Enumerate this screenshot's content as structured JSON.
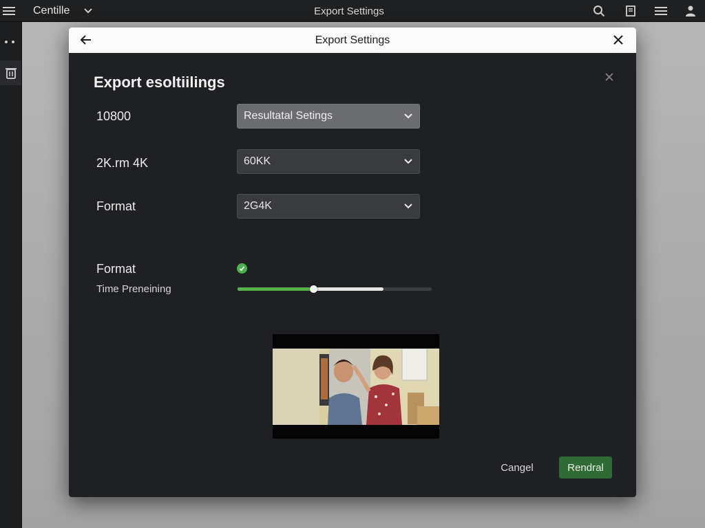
{
  "app": {
    "brand": "Centille",
    "window_title": "Export Settings"
  },
  "dialog": {
    "header_title": "Export Settings",
    "heading": "Export esoltiilings",
    "rows": [
      {
        "label": "10800",
        "value": "Resultatal Setings"
      },
      {
        "label": "2K.rm 4K",
        "value": "60KK"
      },
      {
        "label": "Format",
        "value": "2G4K"
      }
    ],
    "format_label": "Format",
    "time_label": "Time Preneining",
    "progress": {
      "green_fraction": 0.39,
      "white_fraction": 0.75
    },
    "cancel_label": "Cangel",
    "render_label": "Rendral"
  },
  "icons": [
    "hamburger-icon",
    "chevron-down-icon",
    "search-icon",
    "document-icon",
    "list-icon",
    "person-icon",
    "more-icon",
    "trash-icon",
    "arrow-left-icon",
    "close-icon",
    "check-icon"
  ],
  "colors": {
    "accent_green": "#2f6b35",
    "check_green": "#4caf50",
    "dialog_bg": "#1f2023",
    "header_bg": "#fafafa"
  }
}
